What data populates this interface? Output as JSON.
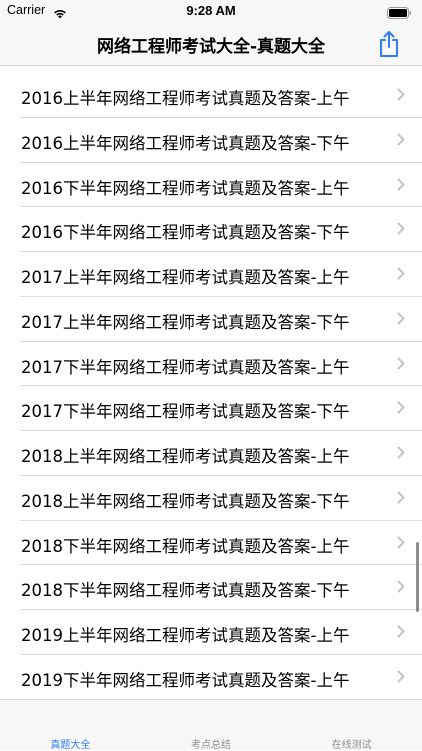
{
  "status_bar": {
    "carrier": "Carrier",
    "time": "9:28 AM"
  },
  "nav": {
    "title": "网络工程师考试大全-真题大全",
    "share_icon": "share-icon",
    "accent_color": "#2f7cf6"
  },
  "list": {
    "items": [
      {
        "label": "2016上半年网络工程师考试真题及答案-上午"
      },
      {
        "label": "2016上半年网络工程师考试真题及答案-下午"
      },
      {
        "label": "2016下半年网络工程师考试真题及答案-上午"
      },
      {
        "label": "2016下半年网络工程师考试真题及答案-下午"
      },
      {
        "label": "2017上半年网络工程师考试真题及答案-上午"
      },
      {
        "label": "2017上半年网络工程师考试真题及答案-下午"
      },
      {
        "label": "2017下半年网络工程师考试真题及答案-上午"
      },
      {
        "label": "2017下半年网络工程师考试真题及答案-下午"
      },
      {
        "label": "2018上半年网络工程师考试真题及答案-上午"
      },
      {
        "label": "2018上半年网络工程师考试真题及答案-下午"
      },
      {
        "label": "2018下半年网络工程师考试真题及答案-上午"
      },
      {
        "label": "2018下半年网络工程师考试真题及答案-下午"
      },
      {
        "label": "2019上半年网络工程师考试真题及答案-上午"
      },
      {
        "label": "2019下半年网络工程师考试真题及答案-上午"
      }
    ]
  },
  "tab_bar": {
    "tabs": [
      {
        "label": "真题大全",
        "selected": true
      },
      {
        "label": "考点总结",
        "selected": false
      },
      {
        "label": "在线测试",
        "selected": false
      }
    ],
    "selected_color": "#2f7cf6",
    "unselected_color": "#8e8e93"
  }
}
